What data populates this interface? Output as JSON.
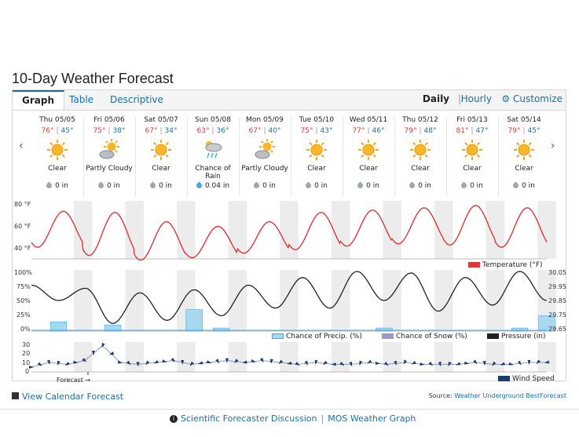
{
  "page": {
    "title": "10-Day Weather Forecast"
  },
  "tabs": [
    "Graph",
    "Table",
    "Descriptive"
  ],
  "view": {
    "daily": "Daily",
    "separator": "|",
    "hourly": "Hourly",
    "customize": "Customize"
  },
  "days": [
    {
      "date": "Thu 05/05",
      "hi": "76°",
      "lo": "45°",
      "cond": "Clear",
      "icon": "sun-icon",
      "precip": "0 in"
    },
    {
      "date": "Fri 05/06",
      "hi": "75°",
      "lo": "38°",
      "cond": "Partly Cloudy",
      "icon": "partly-cloudy-icon",
      "precip": "0 in"
    },
    {
      "date": "Sat 05/07",
      "hi": "67°",
      "lo": "34°",
      "cond": "Clear",
      "icon": "sun-icon",
      "precip": "0 in"
    },
    {
      "date": "Sun 05/08",
      "hi": "63°",
      "lo": "36°",
      "cond": "Chance of Rain",
      "icon": "rain-icon",
      "precip": "0.04 in"
    },
    {
      "date": "Mon 05/09",
      "hi": "67°",
      "lo": "40°",
      "cond": "Partly Cloudy",
      "icon": "partly-cloudy-icon",
      "precip": "0 in"
    },
    {
      "date": "Tue 05/10",
      "hi": "75°",
      "lo": "43°",
      "cond": "Clear",
      "icon": "sun-icon",
      "precip": "0 in"
    },
    {
      "date": "Wed 05/11",
      "hi": "77°",
      "lo": "46°",
      "cond": "Clear",
      "icon": "sun-icon",
      "precip": "0 in"
    },
    {
      "date": "Thu 05/12",
      "hi": "79°",
      "lo": "48°",
      "cond": "Clear",
      "icon": "sun-icon",
      "precip": "0 in"
    },
    {
      "date": "Fri 05/13",
      "hi": "81°",
      "lo": "47°",
      "cond": "Clear",
      "icon": "sun-icon",
      "precip": "0 in"
    },
    {
      "date": "Sat 05/14",
      "hi": "79°",
      "lo": "45°",
      "cond": "Clear",
      "icon": "sun-icon",
      "precip": "0 in"
    }
  ],
  "temp_axis": [
    "80 °F",
    "60 °F",
    "40 °F"
  ],
  "pct_axis": [
    "100%",
    "75%",
    "50%",
    "25%",
    "0%"
  ],
  "pressure_axis": [
    "30.05",
    "29.95",
    "29.85",
    "29.75",
    "29.65"
  ],
  "wind_axis": [
    "30",
    "20",
    "10",
    "0"
  ],
  "legend": {
    "temperature": "Temperature (°F)",
    "precip": "Chance of Precip. (%)",
    "snow": "Chance of Snow (%)",
    "pressure": "Pressure (in)",
    "wind": "Wind Speed"
  },
  "colors": {
    "temperature": "#d9383a",
    "precip": "#a8d8f0",
    "snow": "#9999cc",
    "pressure": "#222222",
    "wind": "#1a3a7a",
    "link": "#1a6ea8"
  },
  "forecast_label": "Forecast →",
  "footer": {
    "calendar": "View Calendar Forecast",
    "source_prefix": "Source:",
    "source_link": "Weather Underground BestForecast",
    "discussion": "Scientific Forecaster Discussion",
    "link_sep": "|",
    "mos": "MOS Weather Graph"
  },
  "chart_data": [
    {
      "type": "line",
      "name": "Temperature (°F)",
      "x": [
        "Thu 05/05",
        "Fri 05/06",
        "Sat 05/07",
        "Sun 05/08",
        "Mon 05/09",
        "Tue 05/10",
        "Wed 05/11",
        "Thu 05/12",
        "Fri 05/13",
        "Sat 05/14"
      ],
      "series": [
        {
          "name": "High",
          "values": [
            76,
            75,
            67,
            63,
            67,
            75,
            77,
            79,
            81,
            79
          ]
        },
        {
          "name": "Low",
          "values": [
            45,
            38,
            34,
            36,
            40,
            43,
            46,
            48,
            47,
            45
          ]
        }
      ],
      "ylim": [
        35,
        85
      ]
    },
    {
      "type": "line",
      "series": [
        {
          "name": "Pressure (in)",
          "values": [
            29.95,
            29.85,
            29.93,
            29.7,
            29.9,
            29.72,
            29.92,
            29.75,
            29.95,
            29.8,
            30.0,
            29.8,
            30.04,
            29.85,
            30.03,
            29.78,
            30.0,
            29.82,
            30.04,
            29.85
          ]
        },
        {
          "name": "Chance of Precip. (%)",
          "values": [
            0,
            15,
            0,
            10,
            0,
            0,
            35,
            5,
            0,
            0,
            0,
            0,
            0,
            5,
            0,
            0,
            0,
            0,
            5,
            25
          ]
        }
      ],
      "ylim": [
        0,
        100
      ],
      "y2lim": [
        29.65,
        30.05
      ]
    },
    {
      "type": "line",
      "series": [
        {
          "name": "Wind Speed",
          "values": [
            5,
            10,
            8,
            12,
            28,
            10,
            8,
            10,
            12,
            8,
            10,
            12,
            10,
            12,
            10,
            8,
            10,
            8,
            8,
            10,
            8,
            10,
            8,
            8,
            8,
            10,
            8,
            8,
            10,
            10
          ]
        }
      ],
      "ylim": [
        0,
        30
      ]
    }
  ]
}
